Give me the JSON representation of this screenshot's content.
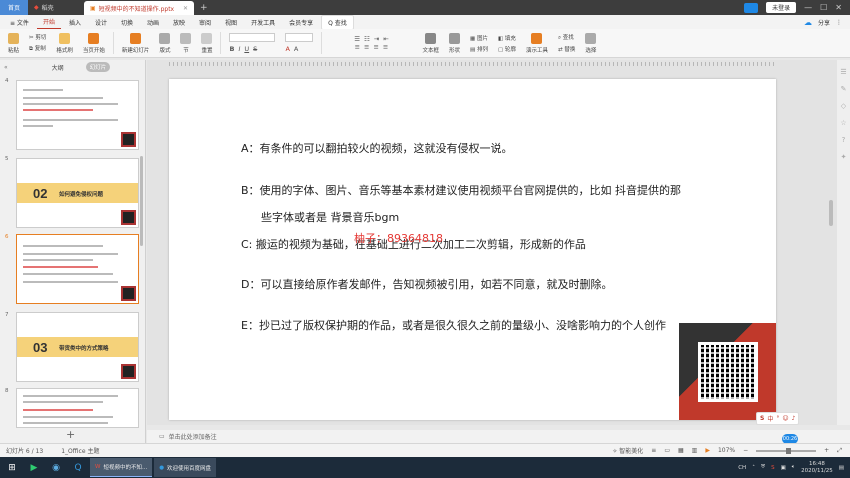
{
  "tabs": {
    "home": "首页",
    "wps": "稻壳",
    "doc": "短视频中的不知道操作.pptx",
    "plus": "+"
  },
  "window": {
    "login": "未登录"
  },
  "menus": {
    "file": "≡ 文件",
    "items": [
      "开始",
      "插入",
      "设计",
      "切换",
      "动画",
      "放映",
      "审阅",
      "视图",
      "开发工具",
      "会员专享"
    ],
    "active": "开始",
    "search": "Q 查找",
    "share": "分享"
  },
  "ribbon": {
    "paste": "粘贴",
    "cut": "剪切",
    "copy": "复制",
    "format_painter": "格式刷",
    "from_current": "当页开始",
    "new_slide": "新建幻灯片",
    "layout": "版式",
    "section": "节",
    "reset": "重置",
    "bold": "B",
    "italic": "I",
    "underline": "U",
    "strike": "S",
    "textbox": "文本框",
    "shape": "形状",
    "picture": "图片",
    "arrange": "排列",
    "fill": "填充",
    "outline": "轮廓",
    "presentation_tools": "演示工具",
    "find": "查找",
    "replace": "替换",
    "select": "选择"
  },
  "leftpanel": {
    "collapse": "«",
    "outline": "大纲",
    "slides": "幻灯片",
    "thumb_numbers": [
      "4",
      "5",
      "6",
      "7",
      "8"
    ],
    "thumb5_num": "02",
    "thumb5_title": "如何避免侵权问题",
    "thumb7_num": "03",
    "thumb7_title": "带货类中的方式策略",
    "add": "+"
  },
  "slide": {
    "para_a": "A：有条件的可以翻拍较火的视频，这就没有侵权一说。",
    "para_b1": "B：使用的字体、图片、音乐等基本素材建议使用视频平台官网提供的，比如 抖音提供的那",
    "para_b2": "些字体或者是 背景音乐bgm",
    "para_c": "C: 搬运的视频为基础，在基础上进行二次加工二次剪辑，形成新的作品",
    "para_d": "D：可以直接给原作者发邮件，告知视频被引用，如若不同意，就及时删除。",
    "para_e": "E：抄已过了版权保护期的作品，或者是很久很久之前的量级小、没啥影响力的个人创作",
    "watermark": "柚子：89364818"
  },
  "notes": {
    "placeholder": "单击此处添加备注"
  },
  "status": {
    "slide_count": "幻灯片 6 / 13",
    "theme": "1_Office 主题",
    "smart": "智能美化",
    "zoom": "107%",
    "badge": "00:26",
    "ime": "中"
  },
  "taskbar": {
    "app1": "短视频中的不知...",
    "app2": "欢迎使用百度网盘",
    "ime": "CH",
    "time": "16:48",
    "date": "2020/11/25"
  },
  "colors": {
    "accent": "#c0392b",
    "home_tab": "#4b8ad6",
    "qr_frame": "#c0392b"
  }
}
